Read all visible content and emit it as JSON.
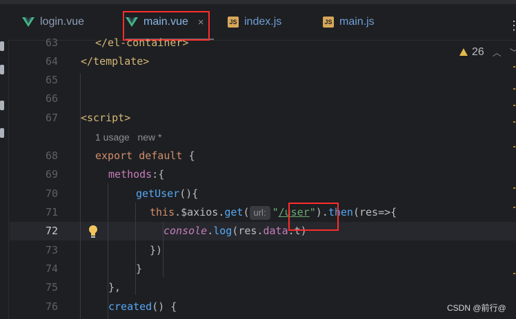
{
  "tabs": [
    {
      "label": "login.vue",
      "type": "vue"
    },
    {
      "label": "main.vue",
      "type": "vue",
      "active": true
    },
    {
      "label": "index.js",
      "type": "js"
    },
    {
      "label": "main.js",
      "type": "js"
    }
  ],
  "js_badge": "JS",
  "close_icon": "×",
  "more_icon": "⋮",
  "inspections": {
    "count": "26"
  },
  "line_numbers": [
    "63",
    "64",
    "65",
    "66",
    "67",
    "68",
    "69",
    "70",
    "71",
    "72",
    "73",
    "74",
    "75",
    "76"
  ],
  "code": {
    "l63": "</el-container>",
    "l64": "</template>",
    "l67": "<script>",
    "usage_hint": "1 usage   new *",
    "l68_kw": "export default",
    "l68_brace": " {",
    "l69_prop": "methods",
    "l69_rest": ":{",
    "l70_fn": "getUser",
    "l70_rest": "(){",
    "l71_this": "this",
    "l71_axios": ".$axios.",
    "l71_get": "get",
    "l71_paren": "(",
    "l71_hint": "url:",
    "l71_quote1": "\"",
    "l71_str": "/user",
    "l71_quote2": "\"",
    "l71_then_pre": ").",
    "l71_then": "then",
    "l71_rest": "(res=>{",
    "l72_console": "console",
    "l72_dot": ".",
    "l72_log": "log",
    "l72_args": "(res.",
    "l72_data": "data",
    "l72_tail": ".t)",
    "l73": "})",
    "l74": "}",
    "l75": "},",
    "l76_fn": "created",
    "l76_rest": "() {"
  },
  "watermark": "CSDN @前行@",
  "colors": {
    "highlight_box": "#ff2d2d",
    "accent_tab": "#88b8e8"
  }
}
